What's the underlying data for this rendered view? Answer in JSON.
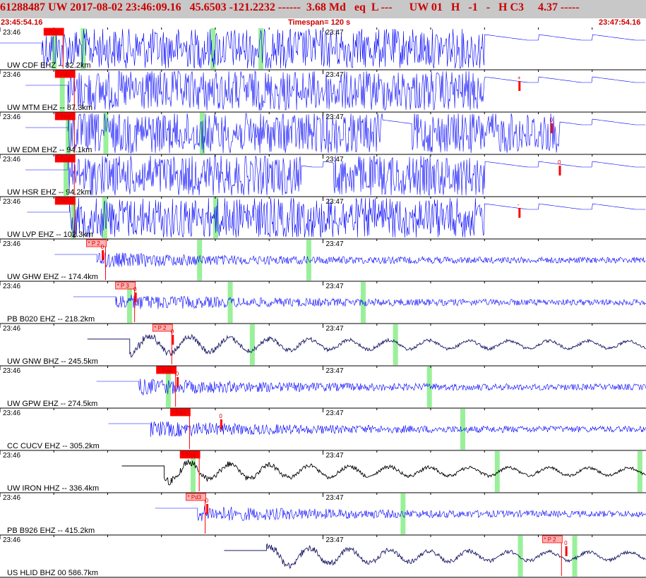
{
  "header": {
    "event_id": "61288487",
    "network": "UW",
    "date": "2017-08-02",
    "time": "23:46:09.16",
    "lat": "45.6503",
    "lon": "-121.2232",
    "dashes": "------",
    "magnitude": "3.68 Md",
    "event_type": "eq",
    "location_type": "L ---",
    "review_tag": "UW 01   H   -1   -   H C3",
    "score": "4.37 -----",
    "start_time": "23:45:54.16",
    "timespan": "Timespan= 120 s",
    "end_time": "23:47:54.16"
  },
  "colors": {
    "header_bg": "#c8c8c8",
    "header_text": "#cc0000",
    "trace_blue": "#0000ff",
    "trace_navy": "#1a1a66",
    "trace_black": "#000000",
    "pick_red": "#ff0000",
    "pick_pink": "#ffb0b0",
    "marker_green": "#9af09a"
  },
  "chart_data": {
    "type": "seismogram",
    "x_range_seconds": [
      0,
      120
    ],
    "tick_labels": [
      "23:46",
      "23:47"
    ],
    "traces": [
      {
        "label": "UW CDF EHZ -- 82.2km",
        "color": "trace_blue",
        "onset": 7.8,
        "clipped": true,
        "gaps": [
          [
            90.0,
            120.0
          ]
        ],
        "pick": {
          "text": "* Pdc",
          "t": 10.0,
          "filled": true
        },
        "green": [
          10.0,
          15.4,
          39.5,
          48.4
        ],
        "marks": []
      },
      {
        "label": "UW MTM EHZ -- 87.3km",
        "color": "trace_blue",
        "onset": 12.6,
        "clipped": true,
        "gaps": [
          [
            90.0,
            120.0
          ]
        ],
        "pick": {
          "text": "* Pdd",
          "t": 12.1,
          "filled": true
        },
        "green": [
          11.5
        ],
        "marks": [
          {
            "t": 96.5,
            "text": "+"
          }
        ]
      },
      {
        "label": "UW EDM EHZ -- 94.1km",
        "color": "trace_blue",
        "onset": 12.6,
        "clipped": true,
        "gaps": [
          [
            71.0,
            76.5
          ],
          [
            104.0,
            120.0
          ]
        ],
        "pick": {
          "text": "* Pdd",
          "t": 12.1,
          "filled": true
        },
        "green": [
          12.6,
          19.6,
          37.5
        ],
        "marks": [
          {
            "t": 102.5,
            "text": "0"
          }
        ]
      },
      {
        "label": "UW HSR EHZ -- 94.2km",
        "color": "trace_blue",
        "onset": 12.6,
        "clipped": true,
        "gaps": [
          [
            56.0,
            62.0
          ],
          [
            90.0,
            120.0
          ]
        ],
        "pick": {
          "text": "* Pdd",
          "t": 12.1,
          "filled": true
        },
        "green": [
          12.2
        ],
        "marks": [
          {
            "t": 104.0,
            "text": "0"
          }
        ]
      },
      {
        "label": "UW LVP EHZ -- 102.3km",
        "color": "trace_blue",
        "onset": 12.9,
        "clipped": true,
        "gaps": [
          [
            90.0,
            120.0
          ]
        ],
        "pick": {
          "text": "* Pdd",
          "t": 12.1,
          "filled": true
        },
        "green": [
          13.6,
          19.4,
          40.0
        ],
        "marks": [
          {
            "t": 96.5,
            "text": "-"
          }
        ]
      },
      {
        "label": "UW GHW EHZ -- 174.4km",
        "color": "trace_blue",
        "onset": 18.0,
        "clipped": false,
        "gaps": [],
        "pick": {
          "text": "* P 2",
          "t": 17.9,
          "filled": false
        },
        "green": [
          37.0,
          57.3
        ],
        "marks": [
          {
            "t": 19.1,
            "text": "0"
          }
        ]
      },
      {
        "label": "PB B020 EHZ -- 218.2km",
        "color": "trace_blue",
        "onset": 21.5,
        "clipped": false,
        "gaps": [],
        "pick": {
          "text": "* P 3",
          "t": 23.3,
          "filled": false
        },
        "green": [
          24.0,
          42.7,
          67.4
        ],
        "marks": [
          {
            "t": 25.2,
            "text": "0"
          }
        ]
      },
      {
        "label": "UW GNW BHZ -- 245.5km",
        "color": "trace_navy",
        "onset": 24.1,
        "clipped": false,
        "gaps": [],
        "pick": {
          "text": "* P 2",
          "t": 30.2,
          "filled": false
        },
        "green": [
          46.8,
          73.4
        ],
        "marks": [
          {
            "t": 32.1,
            "text": "0"
          }
        ]
      },
      {
        "label": "UW GPW EHZ -- 274.5km",
        "color": "trace_blue",
        "onset": 25.8,
        "clipped": false,
        "gaps": [],
        "pick": {
          "text": "* Pdd",
          "t": 30.9,
          "filled": true
        },
        "green": [
          31.2,
          79.7
        ],
        "marks": [
          {
            "t": 33.0,
            "text": "0"
          }
        ]
      },
      {
        "label": "CC CUCV EHZ -- 305.2km",
        "color": "trace_blue",
        "onset": 28.0,
        "clipped": false,
        "gaps": [],
        "pick": {
          "text": "* Pdd",
          "t": 33.5,
          "filled": true
        },
        "green": [
          85.9
        ],
        "marks": [
          {
            "t": 41.1,
            "text": "0"
          }
        ]
      },
      {
        "label": "UW IRON HHZ -- 336.4km",
        "color": "trace_black",
        "onset": 30.5,
        "clipped": false,
        "gaps": [],
        "pick": {
          "text": "* Pdd",
          "t": 35.3,
          "filled": true
        },
        "green": [
          35.8,
          92.3,
          118.8
        ],
        "marks": []
      },
      {
        "label": "PB B926 EHZ -- 415.2km",
        "color": "trace_blue",
        "onset": 36.7,
        "clipped": false,
        "gaps": [],
        "pick": {
          "text": "* Pd3",
          "t": 36.4,
          "filled": false
        },
        "green": [
          74.8
        ],
        "marks": [
          {
            "t": 38.5,
            "text": "0"
          }
        ]
      },
      {
        "label": "US HLID BHZ 00 586.7km",
        "color": "trace_navy",
        "onset": 49.5,
        "clipped": false,
        "gaps": [],
        "pick": {
          "text": "* P 2",
          "t": 102.6,
          "filled": false
        },
        "green": [
          96.6,
          106.7
        ],
        "marks": [
          {
            "t": 105.2,
            "text": "0"
          }
        ]
      }
    ]
  }
}
